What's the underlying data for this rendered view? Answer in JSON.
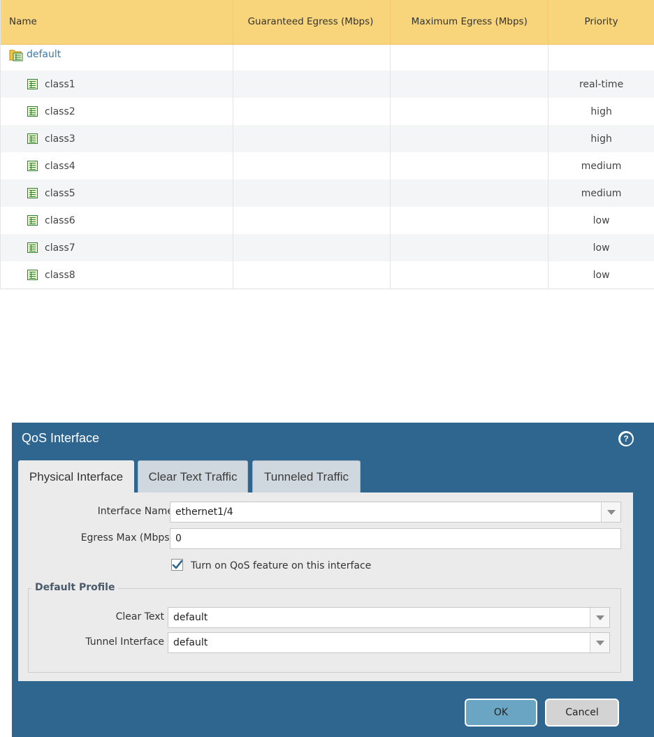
{
  "table": {
    "columns": {
      "name": "Name",
      "guaranteed_egress": "Guaranteed Egress (Mbps)",
      "maximum_egress": "Maximum Egress (Mbps)",
      "priority": "Priority"
    },
    "root": {
      "name": "default"
    },
    "rows": [
      {
        "name": "class1",
        "priority": "real-time"
      },
      {
        "name": "class2",
        "priority": "high"
      },
      {
        "name": "class3",
        "priority": "high"
      },
      {
        "name": "class4",
        "priority": "medium"
      },
      {
        "name": "class5",
        "priority": "medium"
      },
      {
        "name": "class6",
        "priority": "low"
      },
      {
        "name": "class7",
        "priority": "low"
      },
      {
        "name": "class8",
        "priority": "low"
      }
    ]
  },
  "dialog": {
    "title": "QoS Interface",
    "tabs": [
      "Physical Interface",
      "Clear Text Traffic",
      "Tunneled Traffic"
    ],
    "active_tab": "Physical Interface",
    "interface_name": {
      "label": "Interface Name",
      "value": "ethernet1/4"
    },
    "egress_max": {
      "label": "Egress Max (Mbps)",
      "value": "0"
    },
    "qos_toggle": {
      "label": "Turn on QoS feature on this interface",
      "checked": true
    },
    "default_profile": {
      "legend": "Default Profile",
      "clear_text": {
        "label": "Clear Text",
        "value": "default"
      },
      "tunnel_interface": {
        "label": "Tunnel Interface",
        "value": "default"
      }
    },
    "buttons": {
      "ok": "OK",
      "cancel": "Cancel"
    }
  },
  "colors": {
    "header_bg": "#f8d57a",
    "dialog_bg": "#2e6690",
    "ok_button": "#6aa6c4",
    "link_blue": "#3a78a8"
  },
  "icons": {
    "root_row": "folder-grid-icon",
    "class_row": "grid-icon",
    "help": "help-icon",
    "dropdown": "chevron-down-icon",
    "checkbox": "checkmark-icon"
  }
}
